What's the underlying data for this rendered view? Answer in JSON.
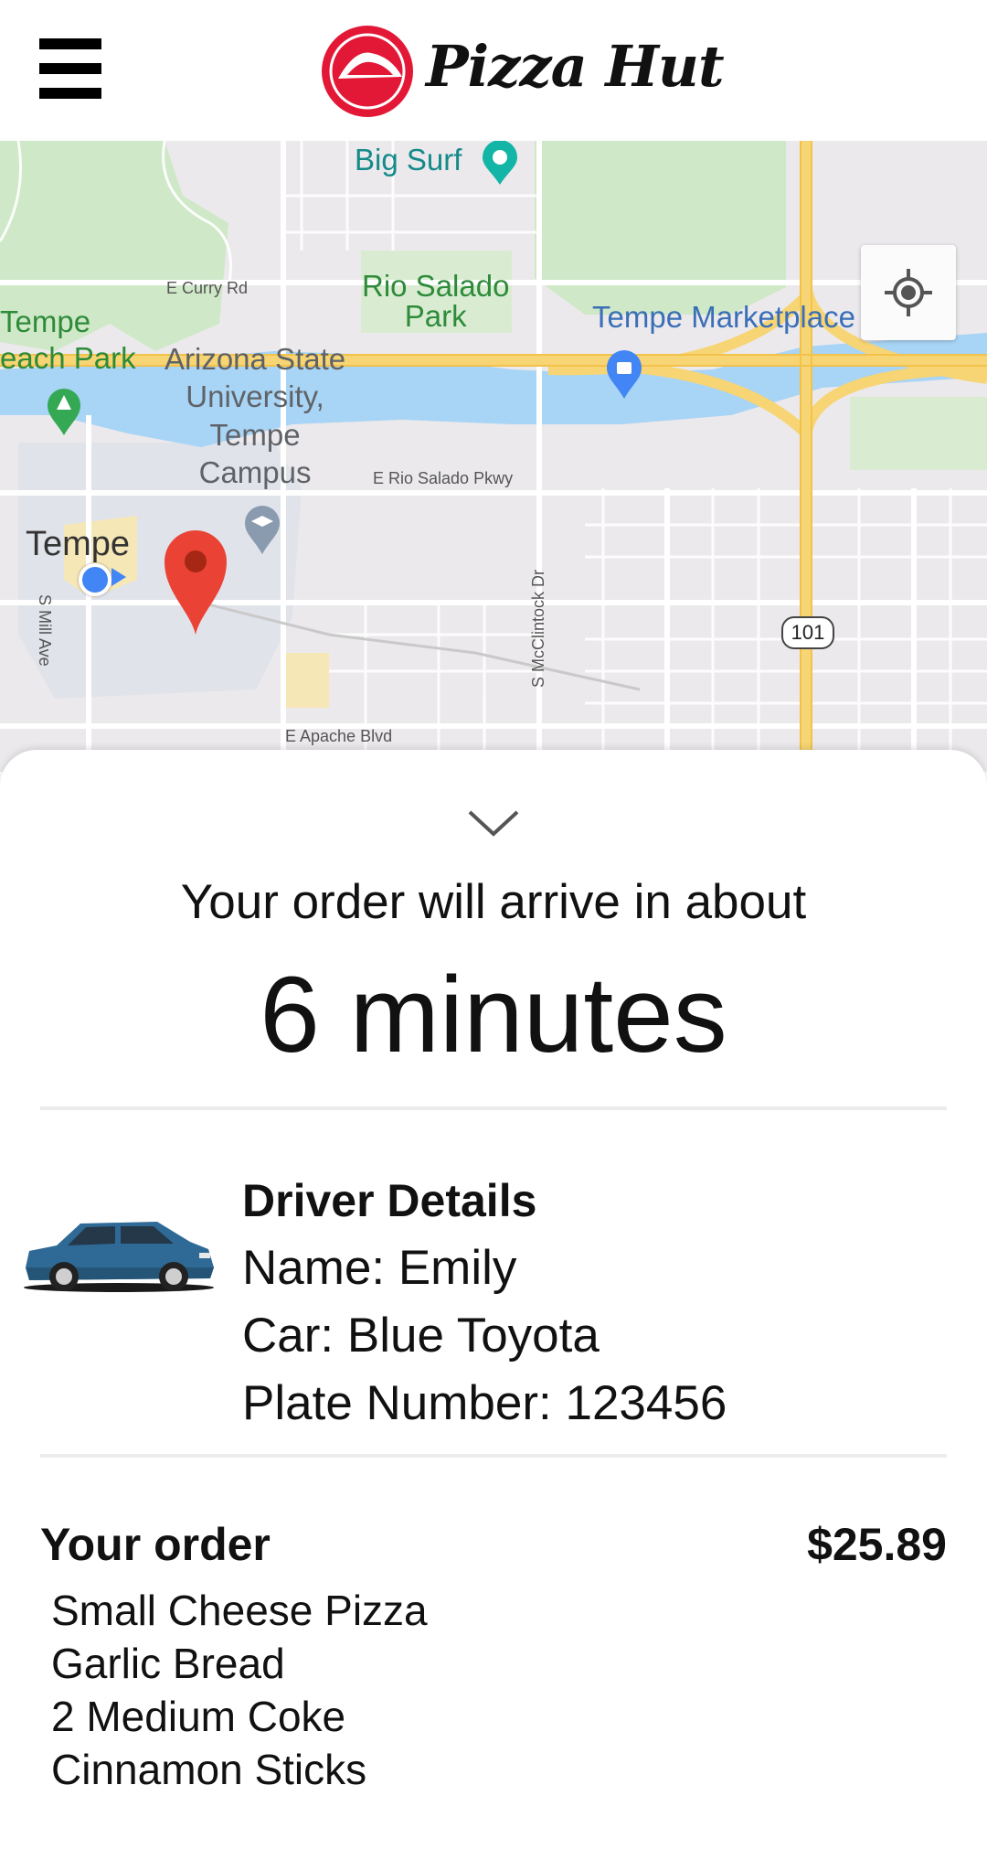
{
  "header": {
    "menu_icon": "hamburger-menu-icon",
    "logo_text": "Pizza Hut",
    "logo_color": "#e31837"
  },
  "map": {
    "labels": {
      "big_surf": "Big Surf",
      "rio_salado_park": "Rio Salado\nPark",
      "tempe_beach_park": "Tempe\neach Park",
      "asu_campus": "Arizona State\nUniversity,\nTempe\nCampus",
      "tempe_marketplace": "Tempe Marketplace",
      "tempe": "Tempe",
      "e_curry_rd": "E Curry Rd",
      "e_rio_salado_pkwy": "E Rio Salado Pkwy",
      "s_mill_ave": "S Mill Ave",
      "s_mcclintock_dr": "S McClintock Dr",
      "e_apache_blvd": "E Apache Blvd",
      "highway_101": "101"
    },
    "locate_icon": "my-location-icon",
    "destination_marker_color": "#ea4335",
    "user_location_color": "#4285f4"
  },
  "sheet": {
    "collapse_icon": "chevron-down-icon",
    "arrive_text": "Your order will arrive in about",
    "arrive_time": "6 minutes"
  },
  "driver": {
    "title": "Driver Details",
    "name": "Name: Emily",
    "car": "Car: Blue Toyota",
    "plate": "Plate Number: 123456",
    "car_icon": "blue-car-icon"
  },
  "order": {
    "title": "Your order",
    "total": "$25.89",
    "items": [
      "Small Cheese Pizza",
      "Garlic Bread",
      "2 Medium Coke",
      "Cinnamon Sticks"
    ]
  }
}
